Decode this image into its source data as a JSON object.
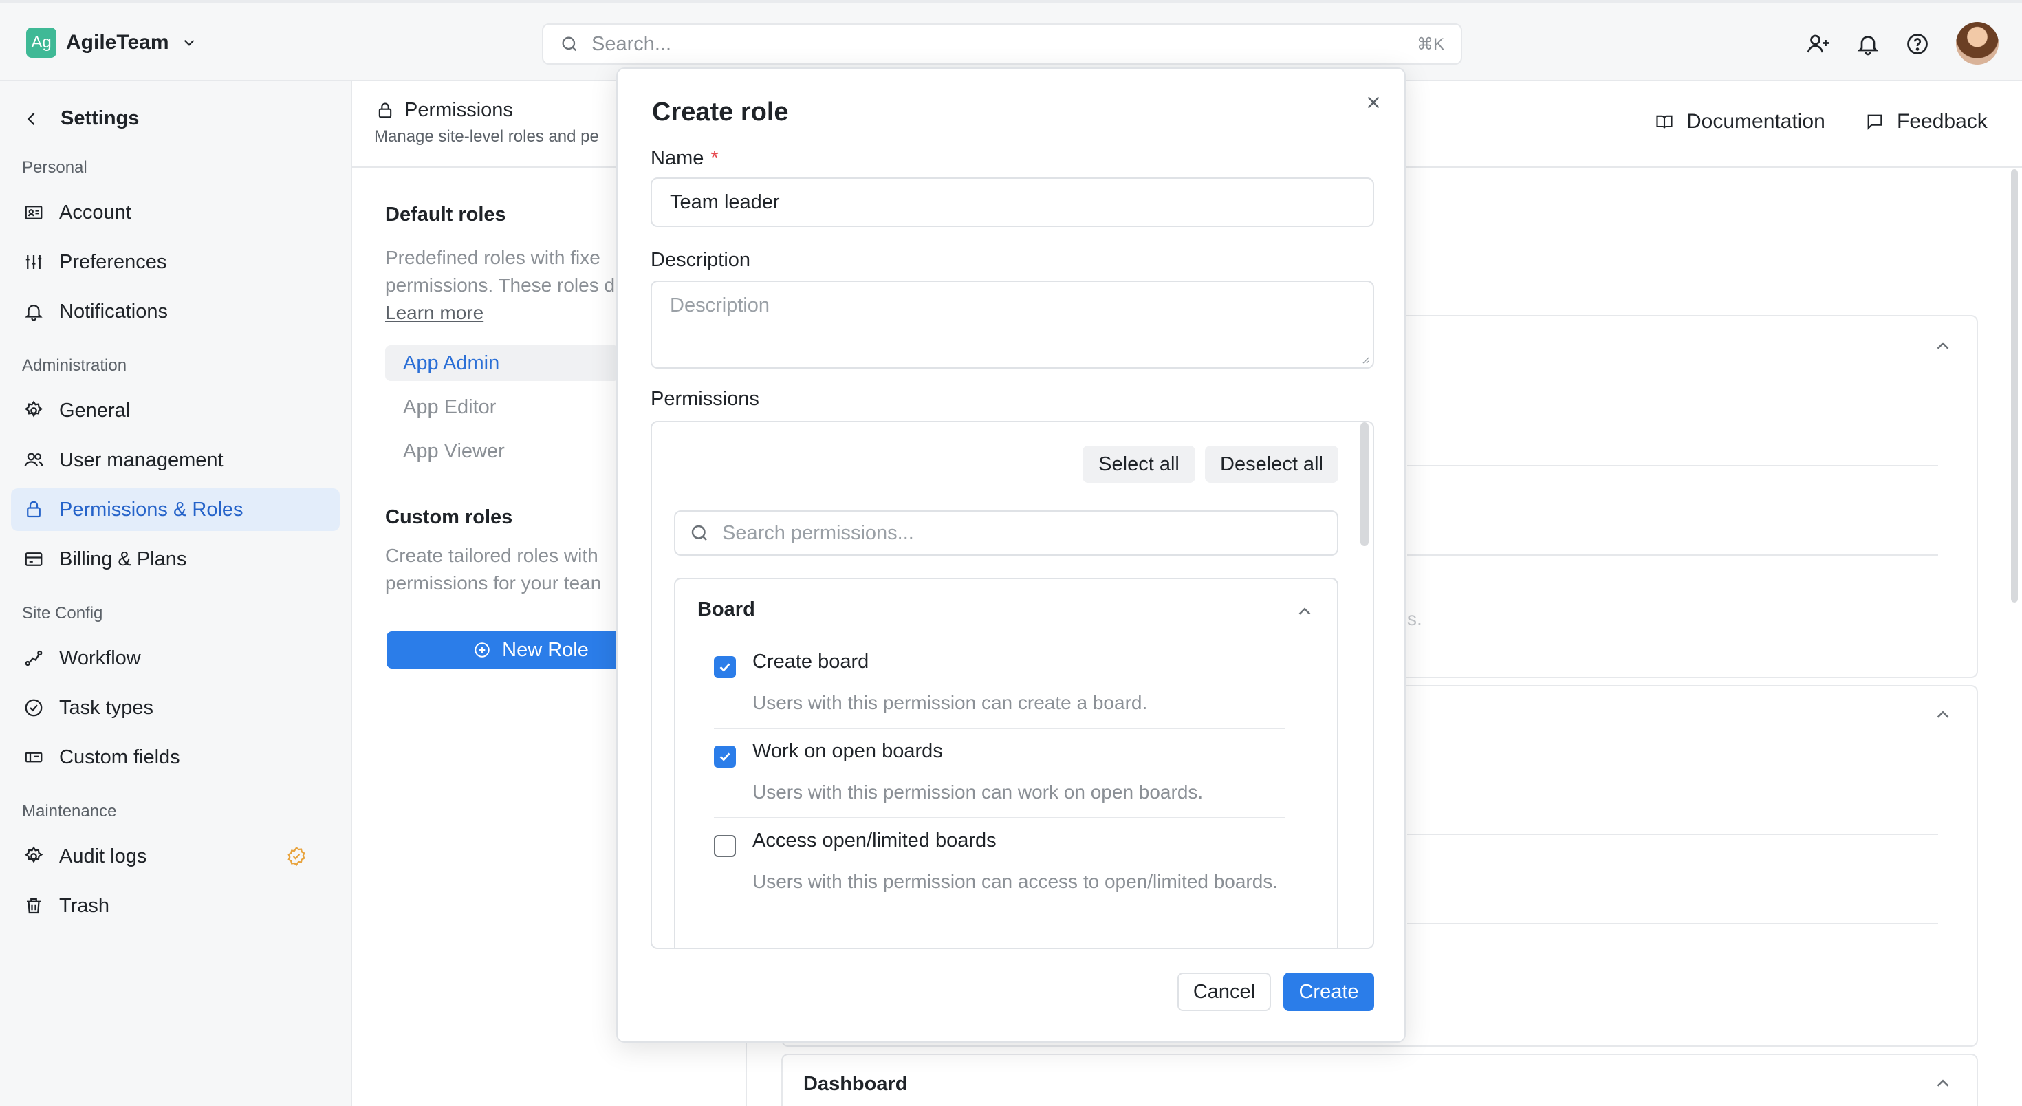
{
  "topbar": {
    "team_initials": "Ag",
    "team_name": "AgileTeam",
    "search_placeholder": "Search...",
    "search_shortcut": "⌘K"
  },
  "sidebar": {
    "title": "Settings",
    "sections": {
      "personal": "Personal",
      "administration": "Administration",
      "site_config": "Site Config",
      "maintenance": "Maintenance"
    },
    "items": {
      "account": "Account",
      "preferences": "Preferences",
      "notifications": "Notifications",
      "general": "General",
      "user_management": "User management",
      "permissions_roles": "Permissions & Roles",
      "billing_plans": "Billing & Plans",
      "workflow": "Workflow",
      "task_types": "Task types",
      "custom_fields": "Custom fields",
      "audit_logs": "Audit logs",
      "trash": "Trash"
    }
  },
  "page": {
    "title": "Permissions",
    "subtitle": "Manage site-level roles and pe",
    "documentation": "Documentation",
    "feedback": "Feedback"
  },
  "roles": {
    "default_heading": "Default roles",
    "default_desc": "Predefined roles with fixe permissions. These roles deleted.",
    "learn_more": "Learn more",
    "default_list": [
      "App Admin",
      "App Editor",
      "App Viewer"
    ],
    "custom_heading": "Custom roles",
    "custom_desc": "Create tailored roles with permissions for your tean",
    "new_role": "New Role"
  },
  "background": {
    "ghost_text": "s.",
    "dashboard_title": "Dashboard"
  },
  "modal": {
    "title": "Create role",
    "name_label": "Name",
    "required_mark": "*",
    "name_value": "Team leader",
    "description_label": "Description",
    "description_placeholder": "Description",
    "permissions_label": "Permissions",
    "select_all": "Select all",
    "deselect_all": "Deselect all",
    "search_placeholder": "Search permissions...",
    "group_title": "Board",
    "permissions": [
      {
        "name": "Create board",
        "desc": "Users with this permission can create a board.",
        "checked": true
      },
      {
        "name": "Work on open boards",
        "desc": "Users with this permission can work on open boards.",
        "checked": true
      },
      {
        "name": "Access open/limited boards",
        "desc": "Users with this permission can access to open/limited boards.",
        "checked": false
      }
    ],
    "cancel": "Cancel",
    "create": "Create"
  },
  "colors": {
    "accent": "#2b7de9",
    "active_nav_bg": "#e3edfa",
    "team_logo": "#3fb996",
    "required": "#e5484d",
    "audit_badge": "#e8a33d"
  }
}
